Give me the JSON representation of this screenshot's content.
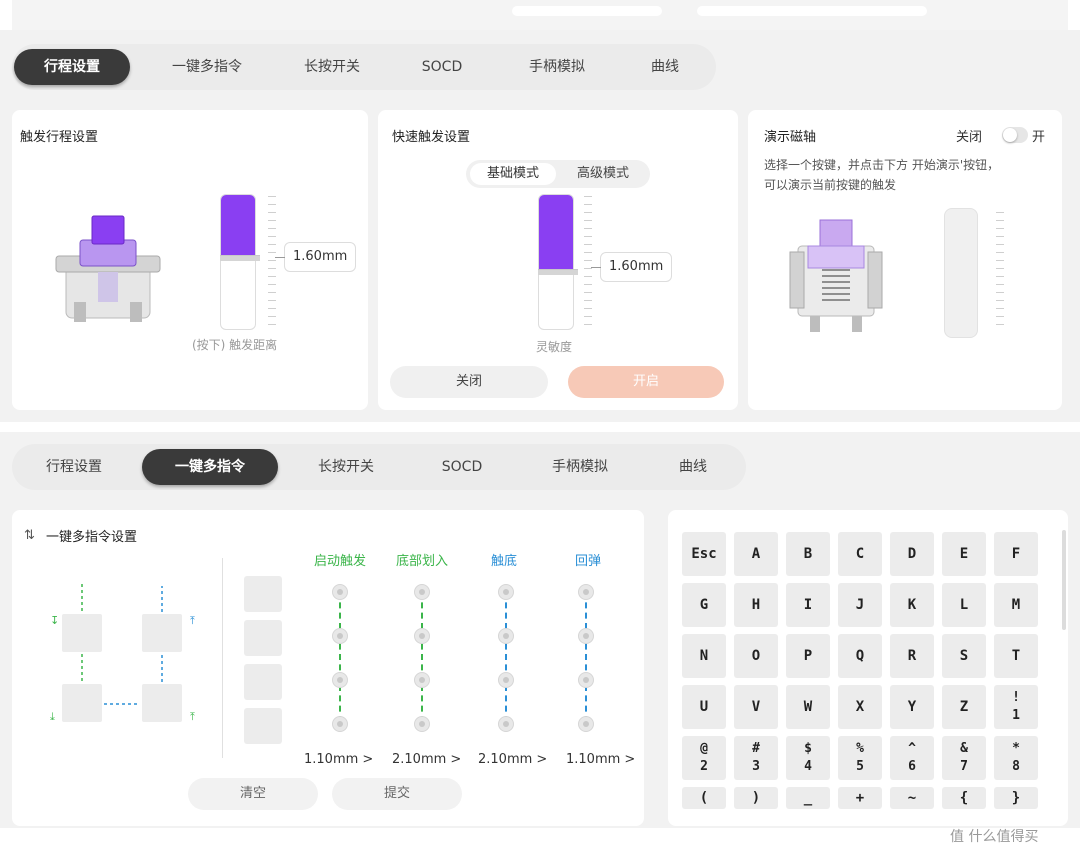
{
  "tabs_top": [
    "行程设置",
    "一键多指令",
    "长按开关",
    "SOCD",
    "手柄模拟",
    "曲线"
  ],
  "tabs_top_active": "行程设置",
  "trigger": {
    "title": "触发行程设置",
    "value": "1.60mm",
    "caption": "(按下) 触发距离",
    "level": 0.45
  },
  "rapid": {
    "title": "快速触发设置",
    "mode_basic": "基础模式",
    "mode_advanced": "高级模式",
    "value": "1.60mm",
    "caption": "灵敏度",
    "off_label": "关闭",
    "on_label": "开启",
    "level": 0.55,
    "on_color": "#f7c9b7"
  },
  "demo": {
    "title": "演示磁轴",
    "toggle_off": "关闭",
    "toggle_on": "开",
    "desc_line1": "选择一个按键，并点击下方 开始演示'按钮，",
    "desc_line2": "可以演示当前按键的触发"
  },
  "tabs_bottom": [
    "行程设置",
    "一键多指令",
    "长按开关",
    "SOCD",
    "手柄模拟",
    "曲线"
  ],
  "tabs_bottom_active": "一键多指令",
  "multi": {
    "title": "一键多指令设置",
    "columns": [
      {
        "label": "启动触发",
        "color": "#3bb54a",
        "value": "1.10mm >"
      },
      {
        "label": "底部划入",
        "color": "#3bb54a",
        "value": "2.10mm >"
      },
      {
        "label": "触底",
        "color": "#2a8fd6",
        "value": "2.10mm >"
      },
      {
        "label": "回弹",
        "color": "#2a8fd6",
        "value": "1.10mm >"
      }
    ],
    "clear_label": "清空",
    "submit_label": "提交"
  },
  "keyboard": {
    "rows": [
      [
        [
          "Esc"
        ],
        [
          "A"
        ],
        [
          "B"
        ],
        [
          "C"
        ],
        [
          "D"
        ],
        [
          "E"
        ],
        [
          "F"
        ]
      ],
      [
        [
          "G"
        ],
        [
          "H"
        ],
        [
          "I"
        ],
        [
          "J"
        ],
        [
          "K"
        ],
        [
          "L"
        ],
        [
          "M"
        ]
      ],
      [
        [
          "N"
        ],
        [
          "O"
        ],
        [
          "P"
        ],
        [
          "Q"
        ],
        [
          "R"
        ],
        [
          "S"
        ],
        [
          "T"
        ]
      ],
      [
        [
          "U"
        ],
        [
          "V"
        ],
        [
          "W"
        ],
        [
          "X"
        ],
        [
          "Y"
        ],
        [
          "Z"
        ],
        [
          "!",
          "1"
        ]
      ],
      [
        [
          "@",
          "2"
        ],
        [
          "#",
          "3"
        ],
        [
          "$",
          "4"
        ],
        [
          "%",
          "5"
        ],
        [
          "^",
          "6"
        ],
        [
          "&",
          "7"
        ],
        [
          "*",
          "8"
        ]
      ],
      [
        [
          "("
        ],
        [
          ")"
        ],
        [
          "_"
        ],
        [
          "+"
        ],
        [
          "~"
        ],
        [
          "{"
        ],
        [
          "}"
        ]
      ]
    ]
  },
  "watermark": "值 什么值得买",
  "colors": {
    "accent": "#8a3ff2",
    "tab_active": "#3a3a3a",
    "green": "#3bb54a",
    "blue": "#2a8fd6"
  }
}
